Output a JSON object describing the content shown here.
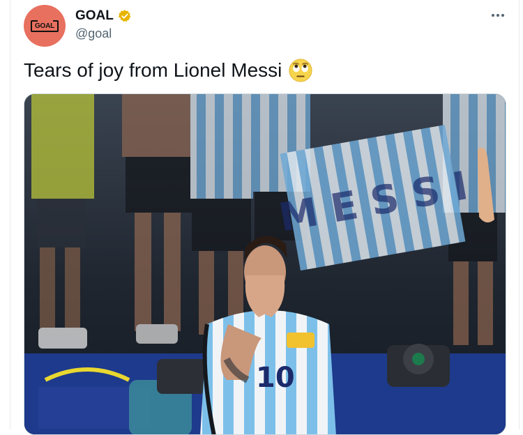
{
  "account": {
    "display_name": "GOAL",
    "handle": "@goal",
    "avatar_text": "GOAL",
    "verified": true,
    "verified_color": "#e8b400"
  },
  "tweet": {
    "text": "Tears of joy from Lionel Messi",
    "emoji": "face-with-rolling-eyes"
  },
  "media": {
    "shirt_number": "10",
    "banner_letters": "M E S S I"
  },
  "colors": {
    "avatar_bg": "#e8705f",
    "argentina_blue": "#6fb8e6",
    "captain_armband": "#f2c12e"
  }
}
